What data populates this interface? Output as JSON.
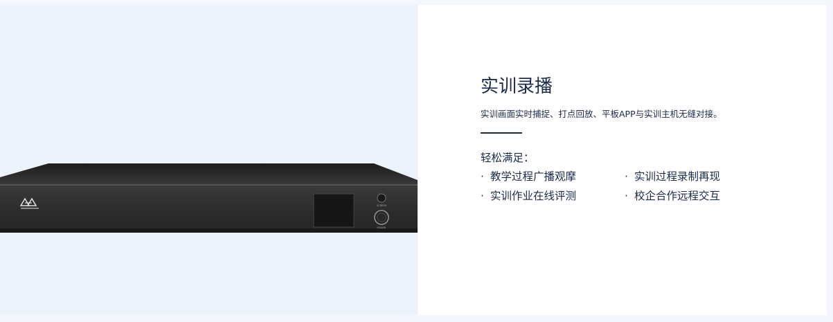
{
  "product": {
    "logo_text": "AVA",
    "screen_label": "SCREEN",
    "power_label": "POWER"
  },
  "content": {
    "title": "实训录播",
    "description": "实训画面实时捕捉、打点回放、平板APP与实训主机无缝对接。",
    "subtitle": "轻松满足：",
    "bullet_symbol": "·",
    "features": [
      "教学过程广播观摩",
      "实训过程录制再现",
      "实训作业在线评测",
      "校企合作远程交互"
    ]
  },
  "colors": {
    "left_background": "#ecf3fb",
    "text": "#1c2a4a",
    "device_body": "#2b2b2b"
  }
}
